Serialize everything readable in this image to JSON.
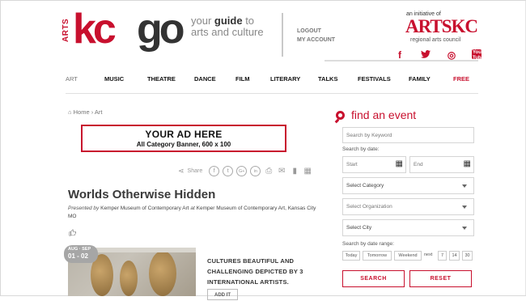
{
  "header": {
    "logo_arts": "ARTS",
    "logo_kc": "kc",
    "logo_go": "go",
    "tagline_pre": "your ",
    "tagline_bold": "guide",
    "tagline_post": " to",
    "tagline_line2": "arts and culture",
    "logout": "LOGOUT",
    "my_account": "MY ACCOUNT",
    "initiative": "an initiative of",
    "artskc": "ARTSKC",
    "council": "regional arts council",
    "social": [
      {
        "icon": "facebook-icon",
        "glyph": "f"
      },
      {
        "icon": "twitter-icon",
        "glyph": "♥"
      },
      {
        "icon": "instagram-icon",
        "glyph": "◎"
      },
      {
        "icon": "youtube-icon",
        "glyph": "You Tube"
      }
    ]
  },
  "nav": {
    "items": [
      "ART",
      "MUSIC",
      "THEATRE",
      "DANCE",
      "FILM",
      "LITERARY",
      "TALKS",
      "FESTIVALS",
      "FAMILY",
      "FREE"
    ]
  },
  "breadcrumb": {
    "home": "⌂ Home",
    "sep": "›",
    "current": "Art"
  },
  "ad": {
    "title": "YOUR AD HERE",
    "subtitle": "All Category Banner, 600 x 100"
  },
  "share": {
    "label": "Share",
    "icons": [
      {
        "icon": "facebook-icon",
        "glyph": "f"
      },
      {
        "icon": "twitter-icon",
        "glyph": "t"
      },
      {
        "icon": "googleplus-icon",
        "glyph": "G+"
      },
      {
        "icon": "linkedin-icon",
        "glyph": "in"
      }
    ],
    "tools": [
      {
        "icon": "print-icon",
        "glyph": "⎙"
      },
      {
        "icon": "email-icon",
        "glyph": "✉"
      },
      {
        "icon": "document-icon",
        "glyph": "▮"
      },
      {
        "icon": "calendar-icon",
        "glyph": "▦"
      }
    ]
  },
  "event": {
    "title": "Worlds Otherwise Hidden",
    "presented_by_label": "Presented by",
    "presenter": "Kemper Museum of Contemporary Art",
    "at_label": "at",
    "venue": "Kemper Museum of Contemporary Art, Kansas City MO",
    "like_icon": "thumbs-up-icon",
    "like_glyph": "👍",
    "date_month": "AUG · SEP",
    "date_days": "01 - 02",
    "description": "CULTURES BEAUTIFUL AND CHALLENGING DEPICTED BY 3 INTERNATIONAL ARTISTS.",
    "add_it": "ADD IT"
  },
  "sidebar": {
    "title": "find an event",
    "keyword_placeholder": "Search by Keyword",
    "by_date_label": "Search by date:",
    "start_placeholder": "Start",
    "end_placeholder": "End",
    "category": "Select Category",
    "organization": "Select Organization",
    "city": "Select City",
    "range_label": "Search by date range:",
    "range_buttons": [
      "Today",
      "Tomorrow",
      "Weekend"
    ],
    "next_label": "next",
    "next_days": [
      "7",
      "14",
      "30"
    ],
    "search_button": "SEARCH",
    "reset_button": "RESET"
  },
  "colors": {
    "accent": "#c8102e",
    "text": "#333333",
    "muted": "#777777"
  }
}
